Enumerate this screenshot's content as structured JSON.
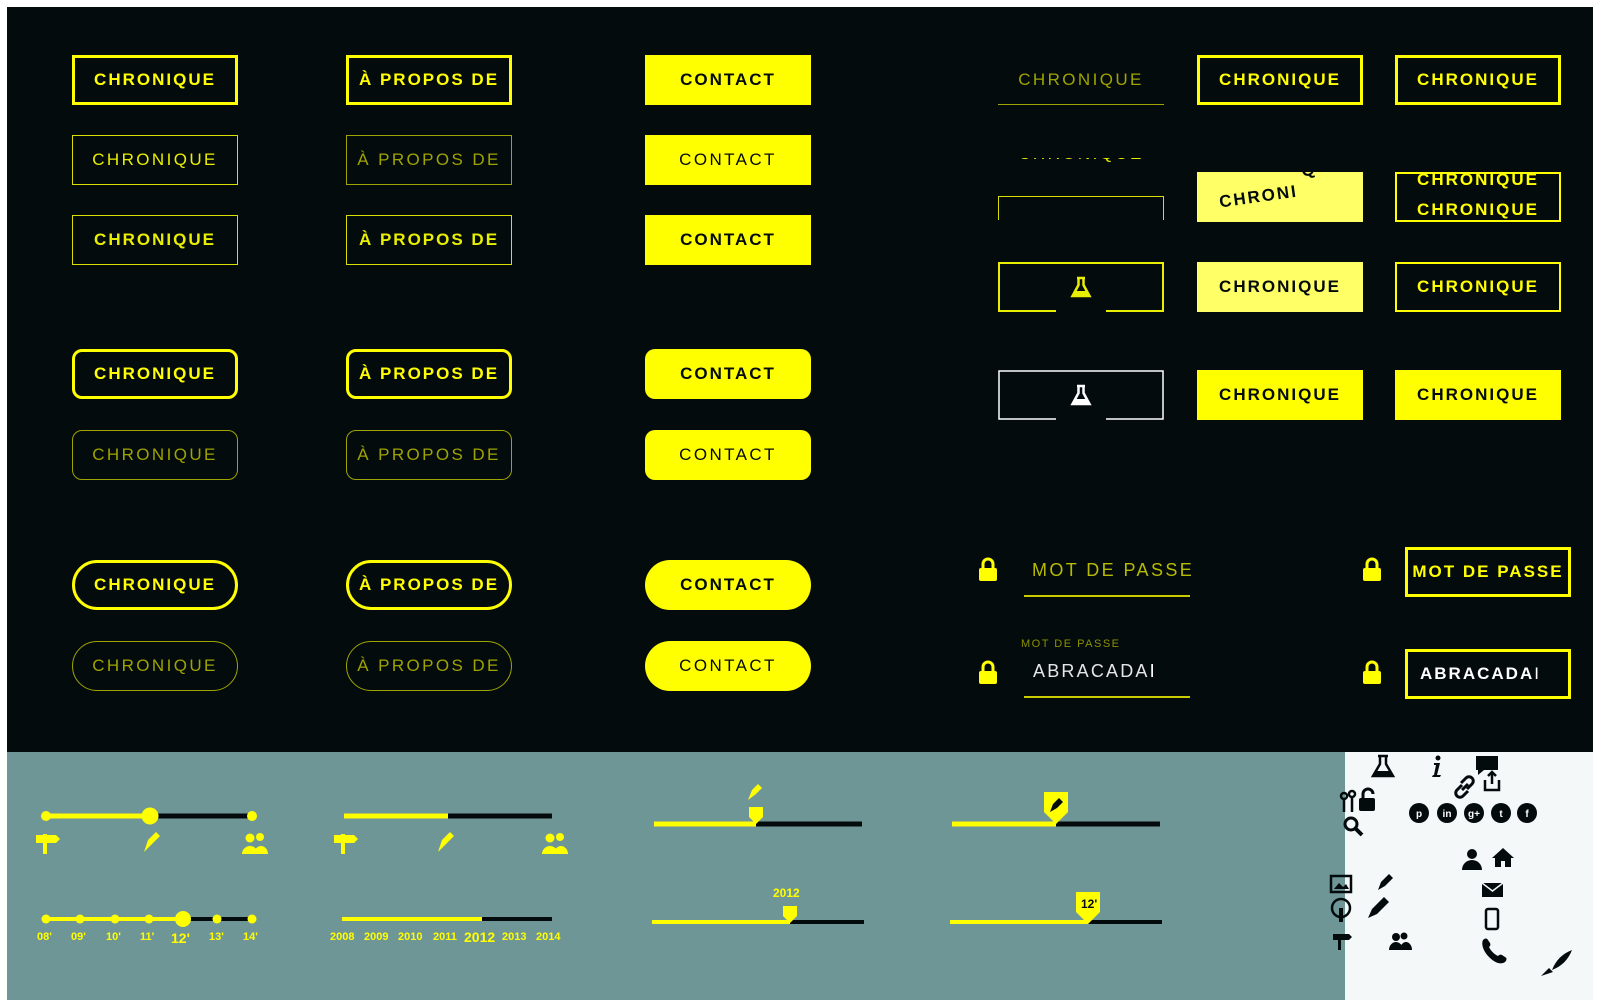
{
  "buttons": {
    "chronique": "CHRONIQUE",
    "apropos": "À PROPOS DE",
    "contact": "CONTACT",
    "chroniquePartial": "CHRONI",
    "chroniqueFlying": "QU"
  },
  "password": {
    "placeholder": "MOT DE PASSE",
    "small_label": "MOT DE PASSE",
    "value": "ABRACADA"
  },
  "sliders": {
    "years_short": [
      "08'",
      "09'",
      "10'",
      "11'",
      "12'",
      "13'",
      "14'"
    ],
    "years_full": [
      "2008",
      "2009",
      "2010",
      "2011",
      "2012",
      "2013",
      "2014"
    ],
    "tooltip_year": "2012",
    "badge_year": "12'"
  },
  "colors": {
    "accent": "#ffff00",
    "dark_bg": "#040b0d",
    "gray_bg": "#6f9697",
    "icons_bg": "#f5f8f8"
  },
  "icons": [
    "flask-icon",
    "info-icon",
    "comment-icon",
    "link-icon",
    "share-icon",
    "tools-icon",
    "unlock-icon",
    "search-icon",
    "pinterest-icon",
    "linkedin-icon",
    "googleplus-icon",
    "twitter-icon",
    "facebook-icon",
    "user-icon",
    "home-icon",
    "image-icon",
    "pencil-icon",
    "mail-icon",
    "tree-icon",
    "mobile-icon",
    "signpost-icon",
    "users-icon",
    "phone-icon",
    "rocket-icon"
  ]
}
